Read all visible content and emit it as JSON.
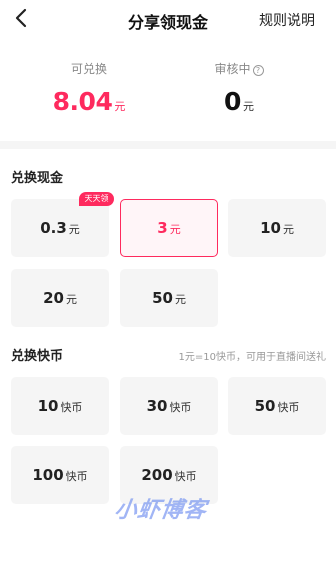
{
  "nav": {
    "title": "分享领现金",
    "rules_label": "规则说明",
    "back_icon": "chevron-left-icon"
  },
  "summary": {
    "available_label": "可兑换",
    "available_value": "8.04",
    "available_unit": "元",
    "review_label": "审核中",
    "review_help_icon": "question-mark-icon",
    "review_help_glyph": "?",
    "review_value": "0",
    "review_unit": "元"
  },
  "cash": {
    "title": "兑换现金",
    "badge": "天天领",
    "options": [
      {
        "amount": "0.3",
        "unit": "元"
      },
      {
        "amount": "3",
        "unit": "元"
      },
      {
        "amount": "10",
        "unit": "元"
      },
      {
        "amount": "20",
        "unit": "元"
      },
      {
        "amount": "50",
        "unit": "元"
      }
    ]
  },
  "coins": {
    "title": "兑换快币",
    "note": "1元=10快币，可用于直播间送礼",
    "options": [
      {
        "amount": "10",
        "unit": "快币"
      },
      {
        "amount": "30",
        "unit": "快币"
      },
      {
        "amount": "50",
        "unit": "快币"
      },
      {
        "amount": "100",
        "unit": "快币"
      },
      {
        "amount": "200",
        "unit": "快币"
      }
    ]
  },
  "watermark": "小虾博客",
  "colors": {
    "accent": "#fe2a5e",
    "card_bg": "#f5f5f5",
    "selected_bg": "#fff5f8"
  }
}
